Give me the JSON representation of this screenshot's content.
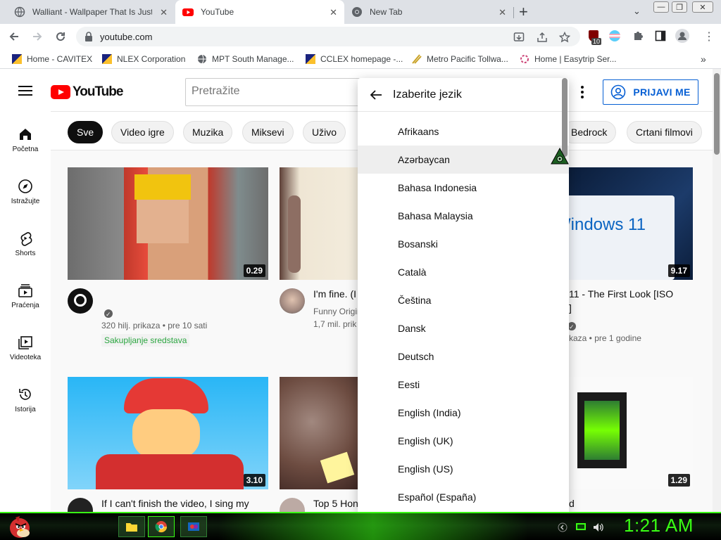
{
  "browser": {
    "tabs": [
      {
        "title": "Walliant - Wallpaper That Is Just",
        "icon": "globe-icon",
        "active": false
      },
      {
        "title": "YouTube",
        "icon": "youtube-icon",
        "active": true
      },
      {
        "title": "New Tab",
        "icon": "chrome-icon",
        "active": false
      }
    ],
    "new_tab_symbol": "+",
    "url": "youtube.com",
    "bookmarks": [
      {
        "label": "Home - CAVITEX"
      },
      {
        "label": "NLEX Corporation"
      },
      {
        "label": "MPT South Manage..."
      },
      {
        "label": "CCLEX homepage -..."
      },
      {
        "label": "Metro Pacific Tollwa..."
      },
      {
        "label": "Home | Easytrip Ser..."
      }
    ],
    "extension_badge": "10",
    "bookmarks_more": "»"
  },
  "youtube": {
    "logo_text": "YouTube",
    "search_placeholder": "Pretražite",
    "signin_label": "PRIJAVI ME",
    "left_nav": [
      {
        "label": "Početna",
        "icon": "home-icon"
      },
      {
        "label": "Istražujte",
        "icon": "explore-compass-icon"
      },
      {
        "label": "Shorts",
        "icon": "shorts-icon"
      },
      {
        "label": "Praćenja",
        "icon": "subscriptions-icon"
      },
      {
        "label": "Videoteka",
        "icon": "library-icon"
      },
      {
        "label": "Istorija",
        "icon": "history-icon"
      }
    ],
    "chips": [
      "Sve",
      "Video igre",
      "Muzika",
      "Miksevi",
      "Uživo",
      "Bedrock",
      "Crtani filmovi"
    ],
    "videos": [
      {
        "duration": "0.29",
        "title": "",
        "meta1": "320 hilj. prikaza • pre 10 sati",
        "badge": "Sakupljanje sredstava"
      },
      {
        "duration": "",
        "title": "I'm fine. (I",
        "channel": "Funny Origin",
        "meta1": "1,7 mil. prik"
      },
      {
        "duration": "9.17",
        "title": "11 - The First Look [ISO",
        "title2": "]",
        "meta1": "kaza • pre 1 godine"
      },
      {
        "duration": "3.10",
        "title": "If I can't finish the video, I sing my"
      },
      {
        "duration": "",
        "title": "Top 5 Hon"
      },
      {
        "duration": "1.29",
        "title": "d"
      }
    ],
    "thumb_text_windows": "Windows 11"
  },
  "language_menu": {
    "title": "Izaberite jezik",
    "hovered_index": 1,
    "items": [
      "Afrikaans",
      "Azərbaycan",
      "Bahasa Indonesia",
      "Bahasa Malaysia",
      "Bosanski",
      "Català",
      "Čeština",
      "Dansk",
      "Deutsch",
      "Eesti",
      "English (India)",
      "English (UK)",
      "English (US)",
      "Español (España)"
    ]
  },
  "taskbar": {
    "clock": "1:21 AM"
  },
  "colors": {
    "yt_red": "#ff0000",
    "signin_blue": "#065fd4",
    "taskbar_green": "#39ff14",
    "verified_green": "#2ba640"
  }
}
